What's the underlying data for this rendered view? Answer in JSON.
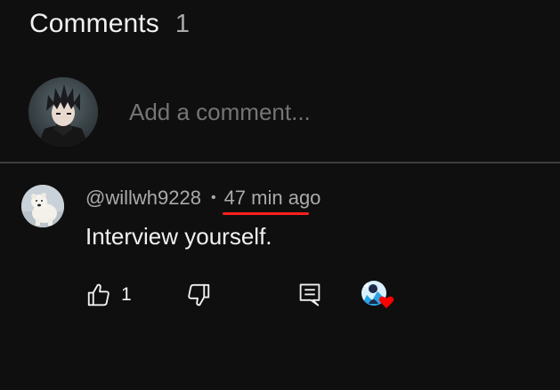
{
  "header": {
    "title": "Comments",
    "count": "1"
  },
  "add_comment": {
    "placeholder": "Add a comment..."
  },
  "comment": {
    "author": "@willwh9228",
    "separator": "•",
    "time": "47 min ago",
    "text": "Interview yourself.",
    "likes": "1"
  },
  "colors": {
    "background": "#0f0f0f",
    "primary_text": "#f1f1f1",
    "secondary_text": "#aaaaaa",
    "divider": "#3d3d3d",
    "highlight_underline": "#ff1f1f",
    "heart": "#ff0000"
  },
  "icons": {
    "like": "thumbs-up-icon",
    "dislike": "thumbs-down-icon",
    "reply": "reply-comment-icon",
    "creator_heart": "creator-heart-icon"
  }
}
